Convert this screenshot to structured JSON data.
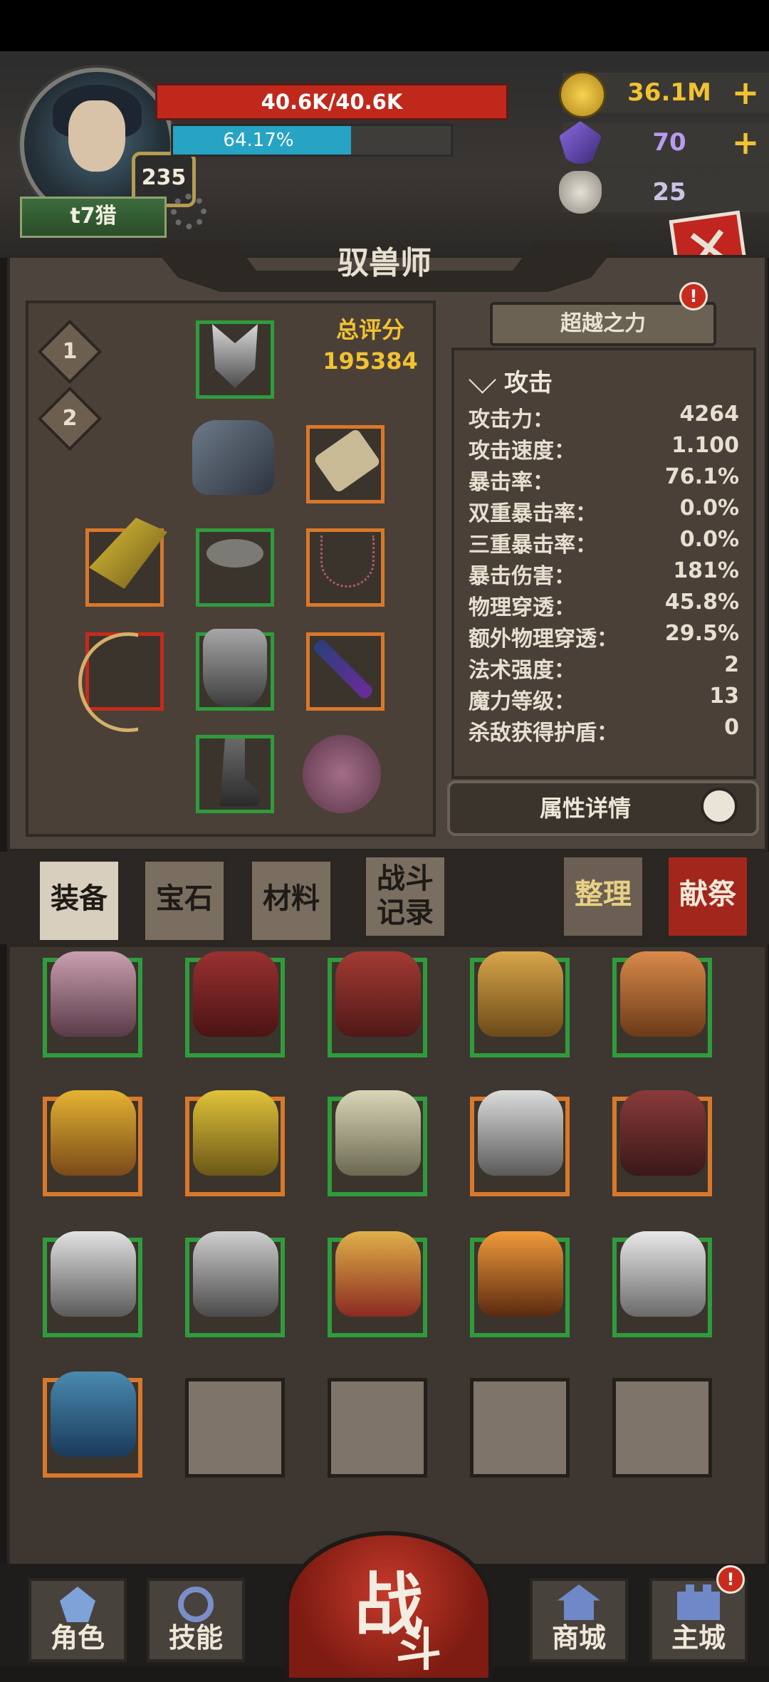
{
  "player": {
    "name": "t7猎",
    "level": "235",
    "hp_text": "40.6K/40.6K",
    "mp_text": "64.17%",
    "mp_progress": 0.6417
  },
  "resources": [
    {
      "icon": "gold-coin-icon",
      "value": "36.1M",
      "plus": "+",
      "color": "#f1c232"
    },
    {
      "icon": "purple-crystal-icon",
      "value": "70",
      "plus": "+",
      "color": "#b79bf0"
    },
    {
      "icon": "ram-skull-icon",
      "value": "25",
      "plus": "",
      "color": "#c9c3e6"
    }
  ],
  "panel": {
    "title": "驭兽师",
    "loadouts": [
      "1",
      "2"
    ],
    "score_label": "总评分",
    "score_value": "195384",
    "transcend_label": "超越之力",
    "transcend_badge": "!"
  },
  "stats": {
    "header": "攻击",
    "rows": [
      {
        "label": "攻击力：",
        "value": "4264"
      },
      {
        "label": "攻击速度：",
        "value": "1.100"
      },
      {
        "label": "暴击率：",
        "value": "76.1%"
      },
      {
        "label": "双重暴击率：",
        "value": "0.0%"
      },
      {
        "label": "三重暴击率：",
        "value": "0.0%"
      },
      {
        "label": "暴击伤害：",
        "value": "181%"
      },
      {
        "label": "物理穿透：",
        "value": "45.8%"
      },
      {
        "label": "额外物理穿透：",
        "value": "29.5%"
      },
      {
        "label": "法术强度：",
        "value": "2"
      },
      {
        "label": "魔力等级：",
        "value": "13"
      },
      {
        "label": "杀敌获得护盾：",
        "value": "0"
      }
    ],
    "details_label": "属性详情"
  },
  "tabs": {
    "equipment": "装备",
    "gems": "宝石",
    "materials": "材料",
    "battle_log_1": "战斗",
    "battle_log_2": "记录",
    "sort": "整理",
    "sacrifice": "献祭"
  },
  "nav": {
    "character": "角色",
    "skills": "技能",
    "battle_1": "战",
    "battle_2": "斗",
    "shop": "商城",
    "city": "主城",
    "city_badge": "!"
  },
  "colors": {
    "hp": "#c0281c",
    "mp": "#27a3c4",
    "score": "#f2c232",
    "rarity_green": "#2f9c3c",
    "rarity_orange": "#d9782a",
    "rarity_red": "#c42b1c"
  }
}
